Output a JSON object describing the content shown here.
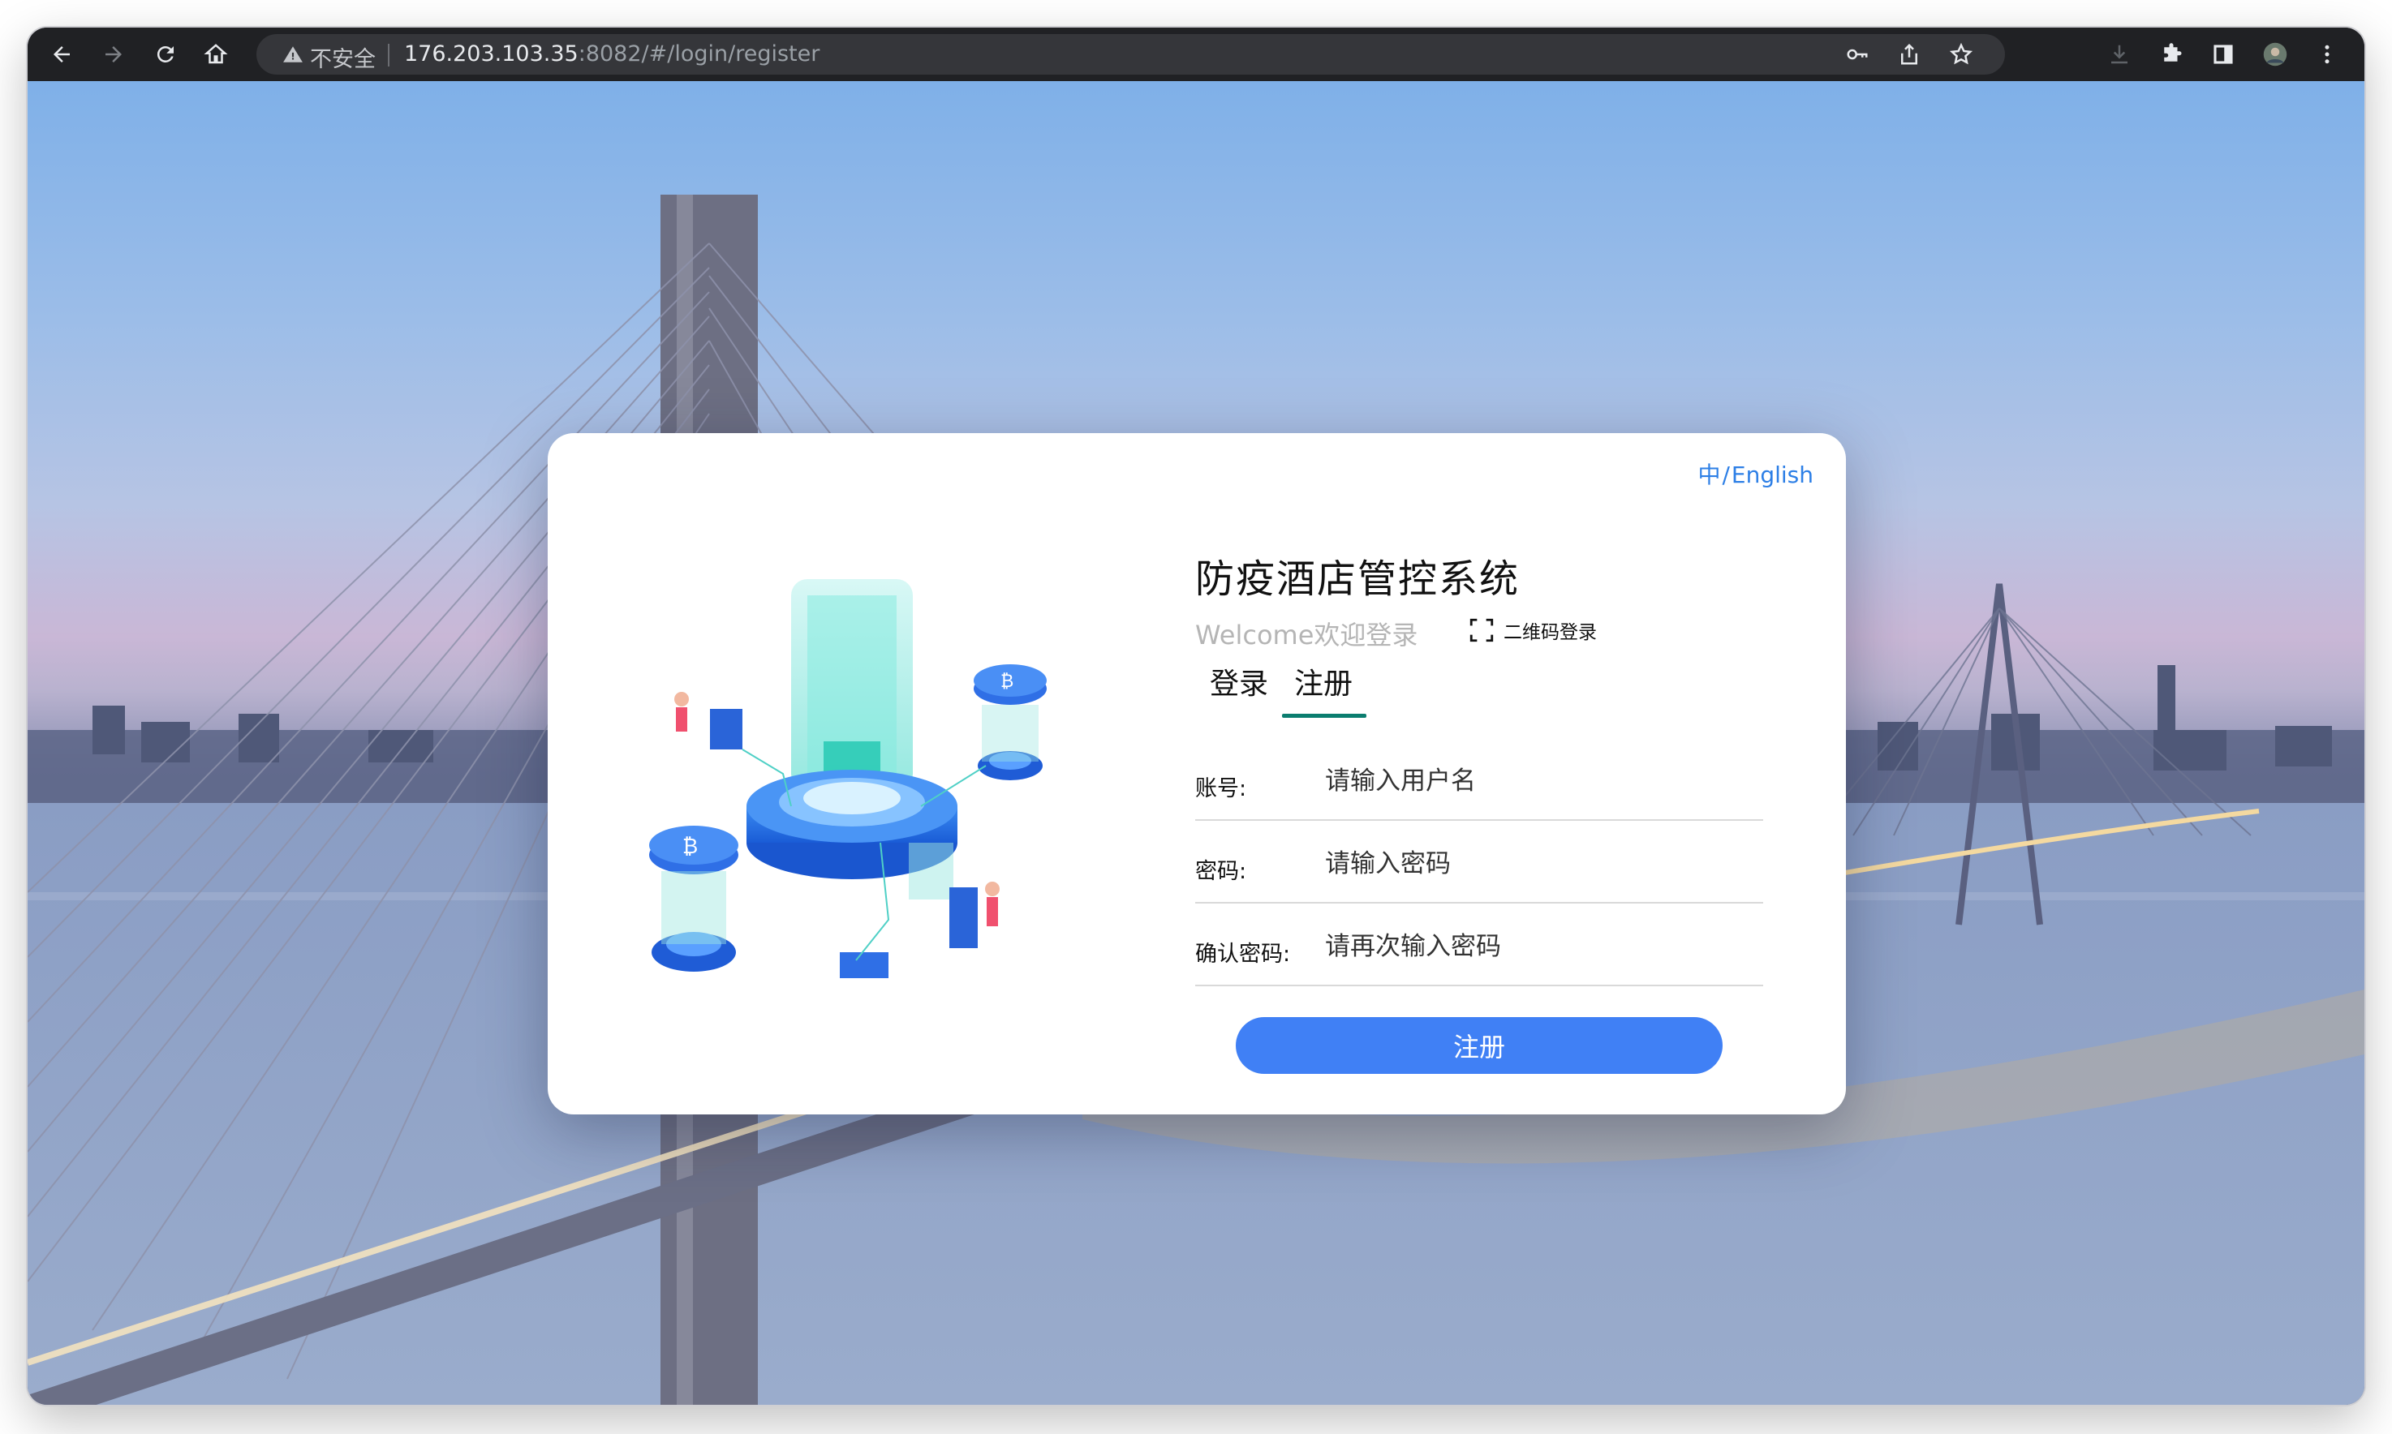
{
  "browser": {
    "security_label": "不安全",
    "url_host": "176.203.103.35",
    "url_rest": ":8082/#/login/register",
    "toolbar_icons": [
      "back-arrow-icon",
      "forward-arrow-icon",
      "reload-icon",
      "home-icon",
      "key-icon",
      "share-icon",
      "star-icon",
      "download-icon",
      "extensions-icon",
      "sidebar-icon",
      "profile-avatar",
      "kebab-menu-icon"
    ]
  },
  "card": {
    "lang_zh": "中",
    "lang_sep": "/",
    "lang_en": "English",
    "title": "防疫酒店管控系统",
    "welcome": "Welcome欢迎登录",
    "qr_login": "二维码登录",
    "tabs": [
      {
        "label": "登录",
        "active": false
      },
      {
        "label": "注册",
        "active": true
      }
    ],
    "fields": [
      {
        "label": "账号:",
        "placeholder": "请输入用户名",
        "value": ""
      },
      {
        "label": "密码:",
        "placeholder": "请输入密码",
        "value": ""
      },
      {
        "label": "确认密码:",
        "placeholder": "请再次输入密码",
        "value": ""
      }
    ],
    "submit_label": "注册"
  },
  "colors": {
    "accent": "#4080f5",
    "tab_underline": "#0b7d6f",
    "lang_link": "#2d7fe6"
  }
}
